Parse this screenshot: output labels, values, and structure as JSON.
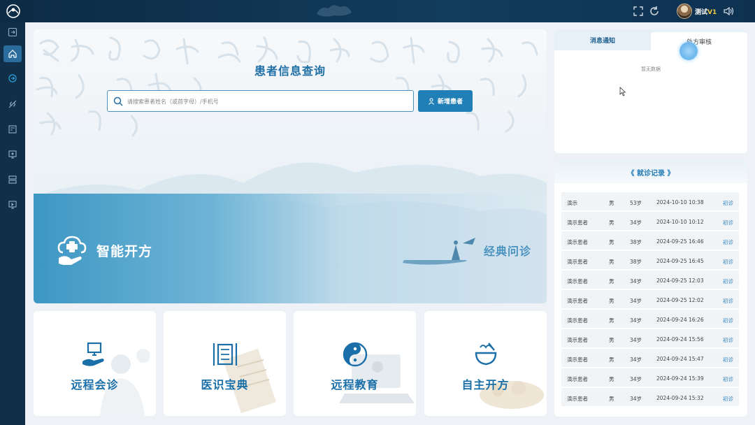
{
  "header": {
    "user_name": "测试",
    "user_level": "V1",
    "icons": [
      "logo-icon",
      "fullscreen-icon",
      "refresh-icon",
      "volume-icon"
    ]
  },
  "sidebar": {
    "items": [
      {
        "icon": "collapse-icon",
        "active": false
      },
      {
        "icon": "home-icon",
        "active": true
      },
      {
        "icon": "send-icon",
        "active": false
      },
      {
        "icon": "herb-icon",
        "active": false
      },
      {
        "icon": "form-icon",
        "active": false
      },
      {
        "icon": "monitor-icon",
        "active": false
      },
      {
        "icon": "server-icon",
        "active": false
      },
      {
        "icon": "screen-icon",
        "active": false
      }
    ]
  },
  "main": {
    "search_title": "患者信息查询",
    "search_placeholder": "请搜索患者姓名（或首字母）/手机号",
    "add_button": "新增患者",
    "smart_label": "智能开方",
    "classic_label": "经典问诊"
  },
  "tiles": [
    {
      "label": "远程会诊",
      "icon": "remote-consult-icon"
    },
    {
      "label": "医识宝典",
      "icon": "medical-book-icon"
    },
    {
      "label": "远程教育",
      "icon": "yin-yang-icon"
    },
    {
      "label": "自主开方",
      "icon": "mortar-icon"
    }
  ],
  "notice": {
    "tab_messages": "消息通知",
    "tab_review": "处方审核",
    "empty_text": "暂无数据"
  },
  "records": {
    "title": "《 就诊记录 》",
    "rows": [
      {
        "name": "演示",
        "sex": "男",
        "age": "53岁",
        "time": "2024-10-10 10:38",
        "type": "初诊"
      },
      {
        "name": "演示患者",
        "sex": "男",
        "age": "34岁",
        "time": "2024-10-10 10:12",
        "type": "初诊"
      },
      {
        "name": "演示患者",
        "sex": "男",
        "age": "38岁",
        "time": "2024-09-25 16:46",
        "type": "初诊"
      },
      {
        "name": "演示患者",
        "sex": "男",
        "age": "38岁",
        "time": "2024-09-25 16:45",
        "type": "初诊"
      },
      {
        "name": "演示患者",
        "sex": "男",
        "age": "34岁",
        "time": "2024-09-25 12:03",
        "type": "初诊"
      },
      {
        "name": "演示患者",
        "sex": "男",
        "age": "34岁",
        "time": "2024-09-25 12:02",
        "type": "初诊"
      },
      {
        "name": "演示患者",
        "sex": "男",
        "age": "34岁",
        "time": "2024-09-24 16:26",
        "type": "初诊"
      },
      {
        "name": "演示患者",
        "sex": "男",
        "age": "34岁",
        "time": "2024-09-24 15:56",
        "type": "初诊"
      },
      {
        "name": "演示患者",
        "sex": "男",
        "age": "34岁",
        "time": "2024-09-24 15:47",
        "type": "初诊"
      },
      {
        "name": "演示患者",
        "sex": "男",
        "age": "34岁",
        "time": "2024-09-24 15:39",
        "type": "初诊"
      },
      {
        "name": "演示患者",
        "sex": "男",
        "age": "34岁",
        "time": "2024-09-24 15:32",
        "type": "初诊"
      }
    ]
  },
  "colors": {
    "topbar": "#0c2b45",
    "sidebar": "#112f49",
    "accent": "#1f7fb6",
    "title_blue": "#1d6fa6"
  }
}
